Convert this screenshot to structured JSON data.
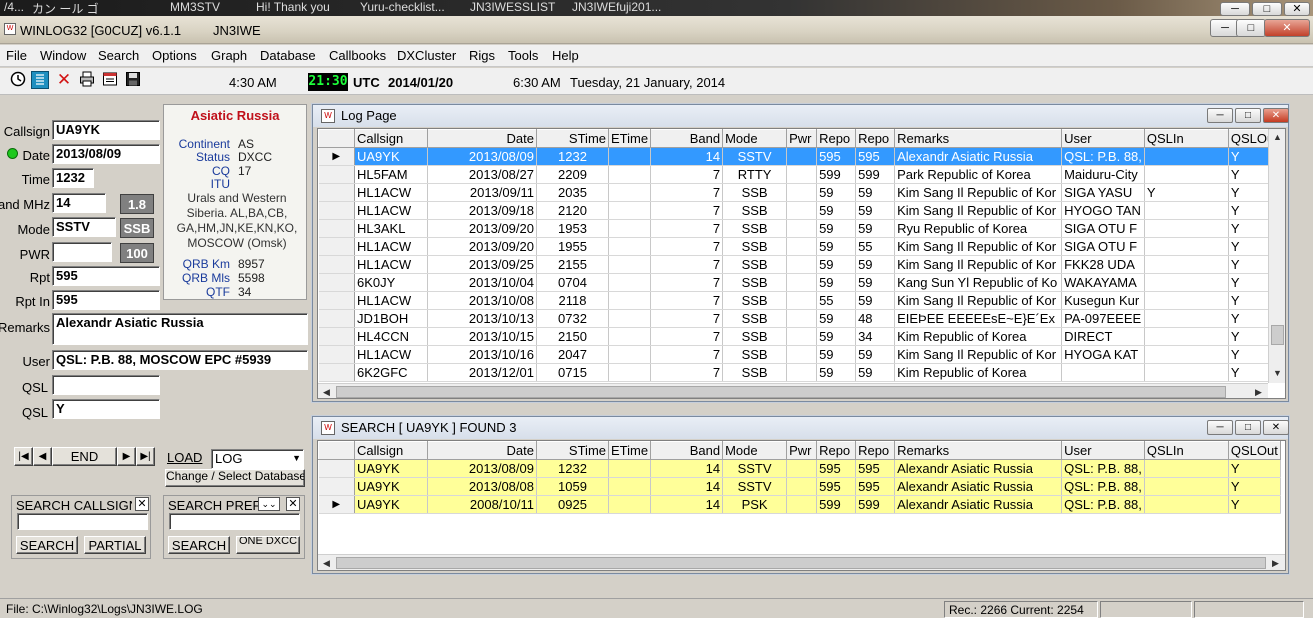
{
  "desktop_strip": {
    "items": [
      "/4...",
      "カン ール ゴ",
      "MM3STV",
      "Hi!  Thank you",
      "Yuru-checklist...",
      "JN3IWESSLIST",
      "JN3IWEfuji201..."
    ]
  },
  "window": {
    "title": "WINLOG32 [G0CUZ]  v6.1.1",
    "operator": "JN3IWE",
    "outer_controls": [
      "─",
      "□",
      "✕"
    ],
    "inner_controls": [
      "─",
      "□",
      "✕"
    ]
  },
  "menu": [
    "File",
    "Window",
    "Search",
    "Options",
    "Graph",
    "Database",
    "Callbooks",
    "DXCluster",
    "Rigs",
    "Tools",
    "Help"
  ],
  "toolbar": {
    "icons": [
      "clock-icon",
      "list-icon",
      "delete-icon",
      "print-icon",
      "notepad-icon",
      "save-icon"
    ],
    "local_time": "4:30 AM",
    "utc_time": "21:30",
    "utc_label": "UTC",
    "utc_date": "2014/01/20",
    "other_time": "6:30 AM",
    "long_date": "Tuesday, 21 January, 2014"
  },
  "entry": {
    "callsign_label": "Callsign",
    "callsign": "UA9YK",
    "date_label": "Date",
    "date": "2013/08/09",
    "time_label": "Time",
    "time": "1232",
    "band_label": "Band MHz",
    "band": "14",
    "band_box": "1.8",
    "mode_label": "Mode",
    "mode": "SSTV",
    "mode_box": "SSB",
    "pwr_label": "PWR",
    "pwr": "",
    "pwr_box": "100",
    "rpt_label": "Rpt",
    "rpt": "595",
    "rptin_label": "Rpt In",
    "rptin": "595",
    "remarks_label": "Remarks",
    "remarks": "Alexandr Asiatic Russia",
    "user_label": "User",
    "user": "QSL: P.B. 88, MOSCOW EPC #5939",
    "qsl1_label": "QSL",
    "qsl1": "",
    "qsl2_label": "QSL",
    "qsl2": "Y"
  },
  "info": {
    "country": "Asiatic Russia",
    "continent_label": "Continent",
    "continent": "AS",
    "status_label": "Status",
    "status": "DXCC",
    "cq_label": "CQ",
    "cq": "17",
    "itu_label": "ITU",
    "itu": "",
    "zone_text": "Urals and Western Siberia. AL,BA,CB, GA,HM,JN,KE,KN,KO, MOSCOW (Omsk)",
    "qrb_km_label": "QRB Km",
    "qrb_km": "8957",
    "qrb_mls_label": "QRB Mls",
    "qrb_mls": "5598",
    "qtf_label": "QTF",
    "qtf": "34"
  },
  "nav": {
    "first": "|◀",
    "prev": "◀",
    "end": "END",
    "next": "▶",
    "last": "▶|",
    "load": "LOAD",
    "log_select": "LOG",
    "change_db": "Change / Select Database"
  },
  "search_call": {
    "title": "SEARCH CALLSIGN",
    "input": "",
    "search": "SEARCH",
    "partial": "PARTIAL"
  },
  "search_prefix": {
    "title": "SEARCH PREFIX",
    "input": "",
    "search": "SEARCH",
    "dxcc": "ONE DXCC"
  },
  "columns": [
    "Callsign",
    "Date",
    "STime",
    "ETime",
    "Band",
    "Mode",
    "Pwr",
    "Repo",
    "Repo",
    "Remarks",
    "User",
    "QSLIn",
    "QSLOut"
  ],
  "log_page": {
    "title": "Log Page",
    "rows": [
      {
        "call": "UA9YK",
        "date": "2013/08/09",
        "stime": "1232",
        "etime": "",
        "band": "14",
        "mode": "SSTV",
        "pwr": "",
        "rs": "595",
        "rr": "595",
        "remarks": "Alexandr Asiatic Russia",
        "user": "QSL: P.B. 88,",
        "qin": "",
        "qout": "Y"
      },
      {
        "call": "HL5FAM",
        "date": "2013/08/27",
        "stime": "2209",
        "etime": "",
        "band": "7",
        "mode": "RTTY",
        "pwr": "",
        "rs": "599",
        "rr": "599",
        "remarks": "Park Republic of Korea",
        "user": "Maiduru-City",
        "qin": "",
        "qout": "Y"
      },
      {
        "call": "HL1ACW",
        "date": "2013/09/11",
        "stime": "2035",
        "etime": "",
        "band": "7",
        "mode": "SSB",
        "pwr": "",
        "rs": "59",
        "rr": "59",
        "remarks": "Kim Sang Il Republic of Kor",
        "user": "SIGA YASU",
        "qin": "Y",
        "qout": "Y"
      },
      {
        "call": "HL1ACW",
        "date": "2013/09/18",
        "stime": "2120",
        "etime": "",
        "band": "7",
        "mode": "SSB",
        "pwr": "",
        "rs": "59",
        "rr": "59",
        "remarks": "Kim Sang Il Republic of Kor",
        "user": "HYOGO TAN",
        "qin": "",
        "qout": "Y"
      },
      {
        "call": "HL3AKL",
        "date": "2013/09/20",
        "stime": "1953",
        "etime": "",
        "band": "7",
        "mode": "SSB",
        "pwr": "",
        "rs": "59",
        "rr": "59",
        "remarks": "Ryu Republic of Korea",
        "user": "SIGA OTU F",
        "qin": "",
        "qout": "Y"
      },
      {
        "call": "HL1ACW",
        "date": "2013/09/20",
        "stime": "1955",
        "etime": "",
        "band": "7",
        "mode": "SSB",
        "pwr": "",
        "rs": "59",
        "rr": "55",
        "remarks": "Kim Sang Il Republic of Kor",
        "user": "SIGA OTU F",
        "qin": "",
        "qout": "Y"
      },
      {
        "call": "HL1ACW",
        "date": "2013/09/25",
        "stime": "2155",
        "etime": "",
        "band": "7",
        "mode": "SSB",
        "pwr": "",
        "rs": "59",
        "rr": "59",
        "remarks": "Kim Sang Il Republic of Kor",
        "user": "FKK28 UDA",
        "qin": "",
        "qout": "Y"
      },
      {
        "call": "6K0JY",
        "date": "2013/10/04",
        "stime": "0704",
        "etime": "",
        "band": "7",
        "mode": "SSB",
        "pwr": "",
        "rs": "59",
        "rr": "59",
        "remarks": "Kang Sun Yl Republic of Ko",
        "user": "WAKAYAMA",
        "qin": "",
        "qout": "Y"
      },
      {
        "call": "HL1ACW",
        "date": "2013/10/08",
        "stime": "2118",
        "etime": "",
        "band": "7",
        "mode": "SSB",
        "pwr": "",
        "rs": "55",
        "rr": "59",
        "remarks": "Kim Sang Il Republic of Kor",
        "user": "Kusegun Kur",
        "qin": "",
        "qout": "Y"
      },
      {
        "call": "JD1BOH",
        "date": "2013/10/13",
        "stime": "0732",
        "etime": "",
        "band": "7",
        "mode": "SSB",
        "pwr": "",
        "rs": "59",
        "rr": "48",
        "remarks": "EIEÞEE EEEEEsE~E}E´Ex",
        "user": "PA-097EEEE",
        "qin": "",
        "qout": "Y"
      },
      {
        "call": "HL4CCN",
        "date": "2013/10/15",
        "stime": "2150",
        "etime": "",
        "band": "7",
        "mode": "SSB",
        "pwr": "",
        "rs": "59",
        "rr": "34",
        "remarks": "Kim Republic of Korea",
        "user": "DIRECT",
        "qin": "",
        "qout": "Y"
      },
      {
        "call": "HL1ACW",
        "date": "2013/10/16",
        "stime": "2047",
        "etime": "",
        "band": "7",
        "mode": "SSB",
        "pwr": "",
        "rs": "59",
        "rr": "59",
        "remarks": "Kim Sang Il Republic of Kor",
        "user": "HYOGA KAT",
        "qin": "",
        "qout": "Y"
      },
      {
        "call": "6K2GFC",
        "date": "2013/12/01",
        "stime": "0715",
        "etime": "",
        "band": "7",
        "mode": "SSB",
        "pwr": "",
        "rs": "59",
        "rr": "59",
        "remarks": "Kim Republic of Korea",
        "user": "",
        "qin": "",
        "qout": "Y"
      }
    ]
  },
  "search_page": {
    "title": "SEARCH [ UA9YK ] FOUND  3",
    "rows": [
      {
        "call": "UA9YK",
        "date": "2013/08/09",
        "stime": "1232",
        "etime": "",
        "band": "14",
        "mode": "SSTV",
        "pwr": "",
        "rs": "595",
        "rr": "595",
        "remarks": "Alexandr Asiatic Russia",
        "user": "QSL: P.B. 88,",
        "qin": "",
        "qout": "Y"
      },
      {
        "call": "UA9YK",
        "date": "2013/08/08",
        "stime": "1059",
        "etime": "",
        "band": "14",
        "mode": "SSTV",
        "pwr": "",
        "rs": "595",
        "rr": "595",
        "remarks": "Alexandr Asiatic Russia",
        "user": "QSL: P.B. 88,",
        "qin": "",
        "qout": "Y"
      },
      {
        "call": "UA9YK",
        "date": "2008/10/11",
        "stime": "0925",
        "etime": "",
        "band": "14",
        "mode": "PSK",
        "pwr": "",
        "rs": "599",
        "rr": "599",
        "remarks": "Alexandr Asiatic Russia",
        "user": "QSL: P.B. 88,",
        "qin": "",
        "qout": "Y"
      }
    ]
  },
  "status": {
    "file": "File: C:\\Winlog32\\Logs\\JN3IWE.LOG",
    "rec": "Rec.: 2266  Current: 2254"
  },
  "colors": {
    "selection": "#3399ff",
    "found_row": "#ffff99",
    "country": "#c0101a",
    "utc_clock": "#1dff3a"
  }
}
